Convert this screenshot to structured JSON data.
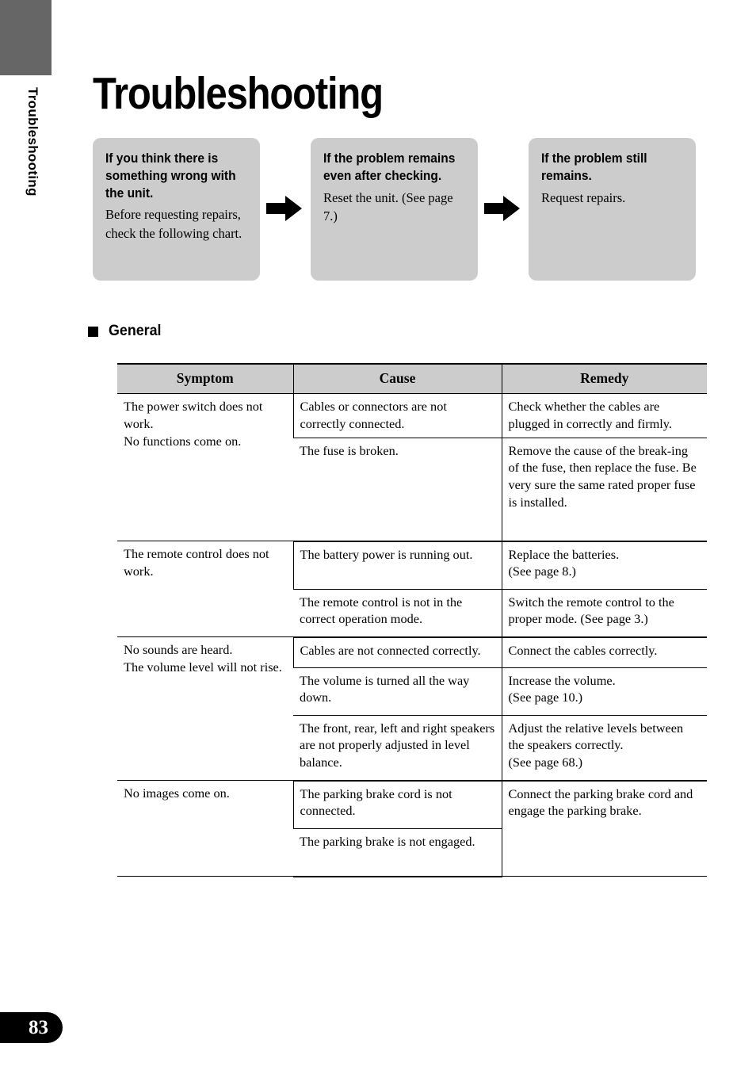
{
  "side": {
    "vertical_label": "Troubleshooting",
    "page_number": "83"
  },
  "page_title": "Troubleshooting",
  "flow": {
    "boxes": [
      {
        "heading": "If you think there is something wrong with the unit.",
        "body": "Before requesting repairs, check the following chart."
      },
      {
        "heading": "If the problem remains even after checking.",
        "body": "Reset the unit. (See page 7.)"
      },
      {
        "heading": "If the problem still remains.",
        "body": "Request repairs."
      }
    ],
    "arrow_icon": "right-arrow-icon"
  },
  "section": {
    "bullet": "square-bullet-icon",
    "label": "General"
  },
  "table": {
    "headers": [
      "Symptom",
      "Cause",
      "Remedy"
    ],
    "groups": [
      {
        "symptom": "The power switch does not work.\nNo functions come on.",
        "rows": [
          {
            "cause": "Cables or connectors are not correctly connected.",
            "remedy": "Check whether the cables are plugged in correctly and firmly."
          },
          {
            "cause": "The fuse is broken.",
            "remedy": "Remove the cause of the break-ing of the fuse, then replace the fuse. Be very sure the same rated proper fuse is installed."
          }
        ]
      },
      {
        "symptom": "The remote control does not work.",
        "rows": [
          {
            "cause": "The battery power is running out.",
            "remedy": "Replace the batteries.\n(See page 8.)"
          },
          {
            "cause": "The remote control is not in the correct operation mode.",
            "remedy": "Switch the remote control to the proper mode. (See page 3.)"
          }
        ]
      },
      {
        "symptom": "No sounds are heard.\nThe volume level will not rise.",
        "rows": [
          {
            "cause": "Cables are not connected correctly.",
            "remedy": "Connect the cables correctly."
          },
          {
            "cause": "The volume is turned all the way down.",
            "remedy": "Increase the volume.\n(See page 10.)"
          },
          {
            "cause": "The front, rear, left and right speakers are not properly adjusted in level balance.",
            "remedy": "Adjust the relative levels between the speakers correctly.\n(See page 68.)"
          }
        ]
      },
      {
        "symptom": "No images come on.",
        "rows": [
          {
            "cause": "The parking brake cord is not connected.",
            "remedy": "Connect the parking brake cord and engage the parking brake."
          },
          {
            "cause": "The parking brake is not engaged.",
            "remedy": ""
          }
        ]
      }
    ]
  },
  "colors": {
    "gray_fill": "#cccccc",
    "tab_gray": "#666666",
    "ink": "#000000"
  }
}
